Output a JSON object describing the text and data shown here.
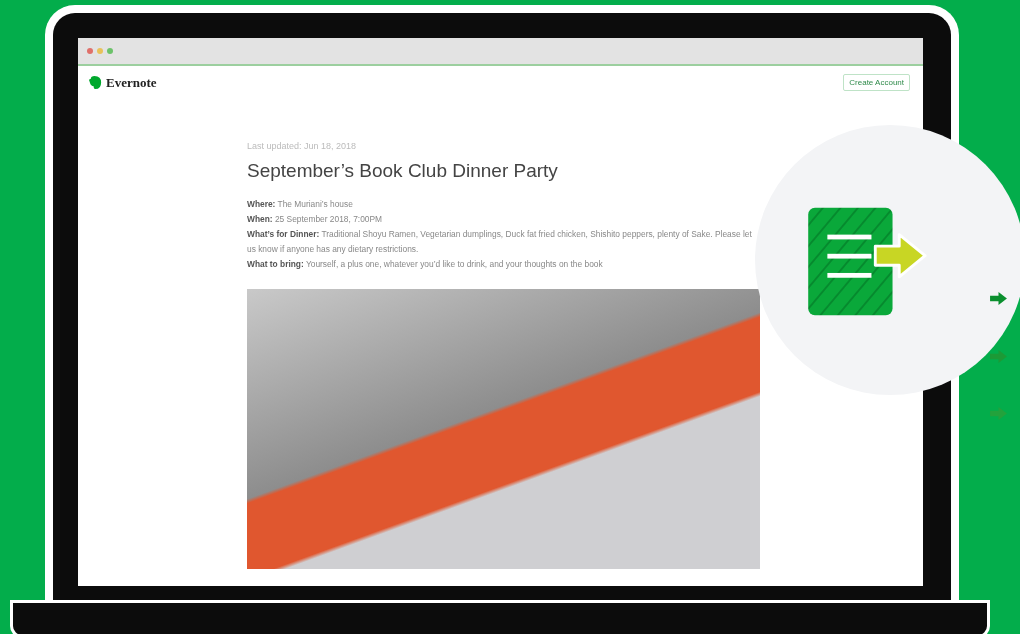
{
  "browser": {
    "brand": "Evernote",
    "button": "Create Account"
  },
  "note": {
    "updated": "Last updated: Jun 18, 2018",
    "title": "September’s Book Club Dinner Party",
    "details": [
      "**Where:** The Muriani’s house",
      "**When:** 25 September 2018, 7:00PM",
      "**What’s for Dinner:** Traditional Shoyu Ramen, Vegetarian dumplings, Duck fat fried chicken, Shishito peppers, plenty of Sake. Please let us know if anyone has any dietary restrictions.",
      "**What to bring:** Yourself, a plus one, whatever you’d like to drink, and your thoughts on the book"
    ]
  }
}
